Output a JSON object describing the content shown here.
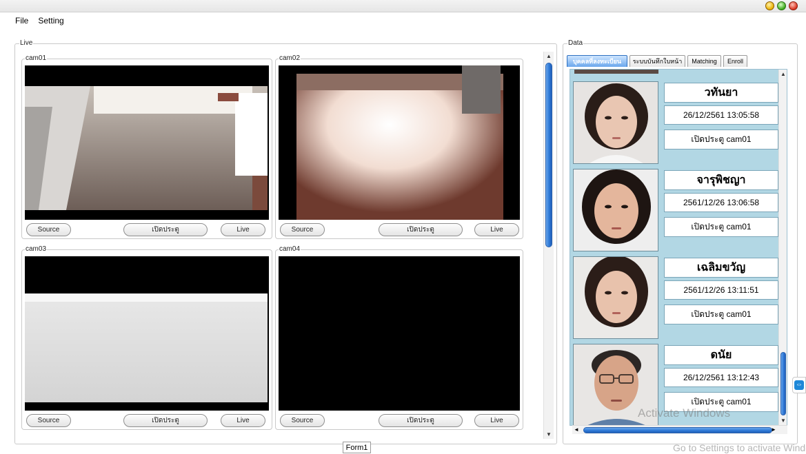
{
  "menu": {
    "file": "File",
    "setting": "Setting"
  },
  "live_panel": {
    "label": "Live"
  },
  "data_panel": {
    "label": "Data"
  },
  "cameras": [
    {
      "label": "cam01",
      "source": "Source",
      "open": "เปิดประตู",
      "live": "Live"
    },
    {
      "label": "cam02",
      "source": "Source",
      "open": "เปิดประตู",
      "live": "Live"
    },
    {
      "label": "cam03",
      "source": "Source",
      "open": "เปิดประตู",
      "live": "Live"
    },
    {
      "label": "cam04",
      "source": "Source",
      "open": "เปิดประตู",
      "live": "Live"
    }
  ],
  "tabs": [
    {
      "label": "บุคคลที่ลงทะเบียน"
    },
    {
      "label": "ระบบบันทึกใบหน้า"
    },
    {
      "label": "Matching"
    },
    {
      "label": "Enroll"
    }
  ],
  "records": [
    {
      "name": "วทันยา",
      "time": "26/12/2561 13:05:58",
      "door": "เปิดประตู cam01"
    },
    {
      "name": "จารุพิชญา",
      "time": "2561/12/26 13:06:58",
      "door": "เปิดประตู cam01"
    },
    {
      "name": "เฉลิมขวัญ",
      "time": "2561/12/26 13:11:51",
      "door": "เปิดประตู cam01"
    },
    {
      "name": "ดนัย",
      "time": "26/12/2561 13:12:43",
      "door": "เปิดประตู cam01"
    }
  ],
  "status": {
    "form": "Form1"
  },
  "watermark": {
    "line1": "Activate Windows",
    "line2": "Go to Settings to activate Windows."
  },
  "colors": {
    "accent": "#2f7ad8",
    "record_bg": "#b2d7e4"
  }
}
